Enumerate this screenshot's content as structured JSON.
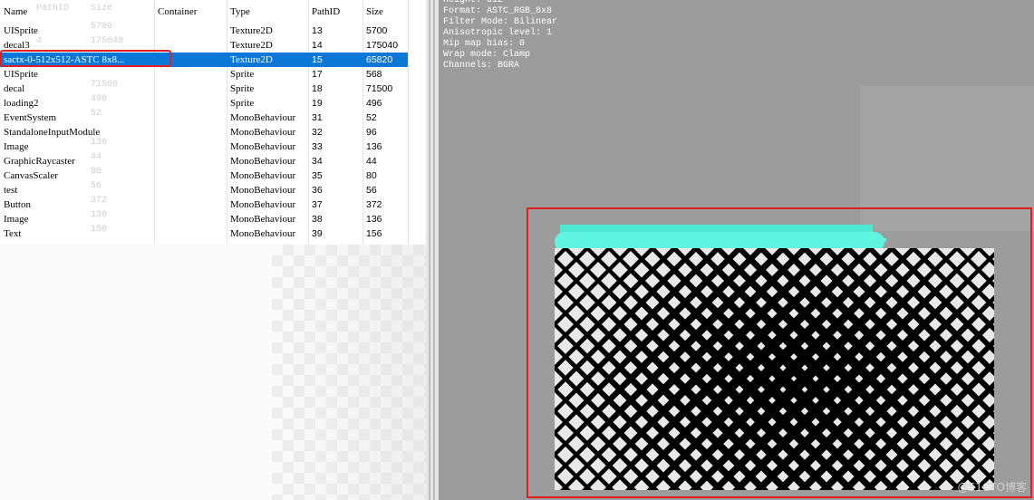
{
  "asset_list": {
    "columns": [
      "Name",
      "Container",
      "Type",
      "PathID",
      "Size"
    ],
    "rows": [
      {
        "name": "UISprite",
        "container": "",
        "type": "Texture2D",
        "path_id": "13",
        "size": "5700"
      },
      {
        "name": "decal3",
        "container": "",
        "type": "Texture2D",
        "path_id": "14",
        "size": "175040"
      },
      {
        "name": "sactx-0-512x512-ASTC 8x8...",
        "container": "",
        "type": "Texture2D",
        "path_id": "15",
        "size": "65820",
        "selected": true
      },
      {
        "name": "UISprite",
        "container": "",
        "type": "Sprite",
        "path_id": "17",
        "size": "568"
      },
      {
        "name": "decal",
        "container": "",
        "type": "Sprite",
        "path_id": "18",
        "size": "71500"
      },
      {
        "name": "loading2",
        "container": "",
        "type": "Sprite",
        "path_id": "19",
        "size": "496"
      },
      {
        "name": "EventSystem",
        "container": "",
        "type": "MonoBehaviour",
        "path_id": "31",
        "size": "52"
      },
      {
        "name": "StandaloneInputModule",
        "container": "",
        "type": "MonoBehaviour",
        "path_id": "32",
        "size": "96"
      },
      {
        "name": "Image",
        "container": "",
        "type": "MonoBehaviour",
        "path_id": "33",
        "size": "136"
      },
      {
        "name": "GraphicRaycaster",
        "container": "",
        "type": "MonoBehaviour",
        "path_id": "34",
        "size": "44"
      },
      {
        "name": "CanvasScaler",
        "container": "",
        "type": "MonoBehaviour",
        "path_id": "35",
        "size": "80"
      },
      {
        "name": "test",
        "container": "",
        "type": "MonoBehaviour",
        "path_id": "36",
        "size": "56"
      },
      {
        "name": "Button",
        "container": "",
        "type": "MonoBehaviour",
        "path_id": "37",
        "size": "372"
      },
      {
        "name": "Image",
        "container": "",
        "type": "MonoBehaviour",
        "path_id": "38",
        "size": "136"
      },
      {
        "name": "Text",
        "container": "",
        "type": "MonoBehaviour",
        "path_id": "39",
        "size": "156"
      }
    ],
    "ghost_header": {
      "pathid": "PathID",
      "size": "Size"
    },
    "ghost_rows": [
      {
        "pathid": "",
        "size": "5700"
      },
      {
        "pathid": "4",
        "size": "175040"
      },
      {
        "pathid": "",
        "size": ""
      },
      {
        "pathid": "",
        "size": ""
      },
      {
        "pathid": "",
        "size": "71500"
      },
      {
        "pathid": "",
        "size": "496"
      },
      {
        "pathid": "",
        "size": "52"
      },
      {
        "pathid": "",
        "size": ""
      },
      {
        "pathid": "",
        "size": "136"
      },
      {
        "pathid": "",
        "size": "44"
      },
      {
        "pathid": "",
        "size": "80"
      },
      {
        "pathid": "",
        "size": "56"
      },
      {
        "pathid": "",
        "size": "372"
      },
      {
        "pathid": "",
        "size": "136"
      },
      {
        "pathid": "",
        "size": "156"
      }
    ]
  },
  "preview": {
    "info_lines": [
      "Height: 512",
      "Format: ASTC_RGB_8x8",
      "Filter Mode: Bilinear",
      "Anisotropic level: 1",
      "Mip map bias: 0",
      "Wrap mode: Clamp",
      "Channels: BGRA"
    ],
    "watermark": "@51CTO博客"
  },
  "colors": {
    "selection": "#0b78d7",
    "highlight_outline": "#e02020",
    "preview_bg": "#9c9c9c",
    "texture_bar": "#5ff5e0",
    "texture_pattern_bg": "#000000",
    "texture_pattern_cells": "#e8e8e8"
  }
}
